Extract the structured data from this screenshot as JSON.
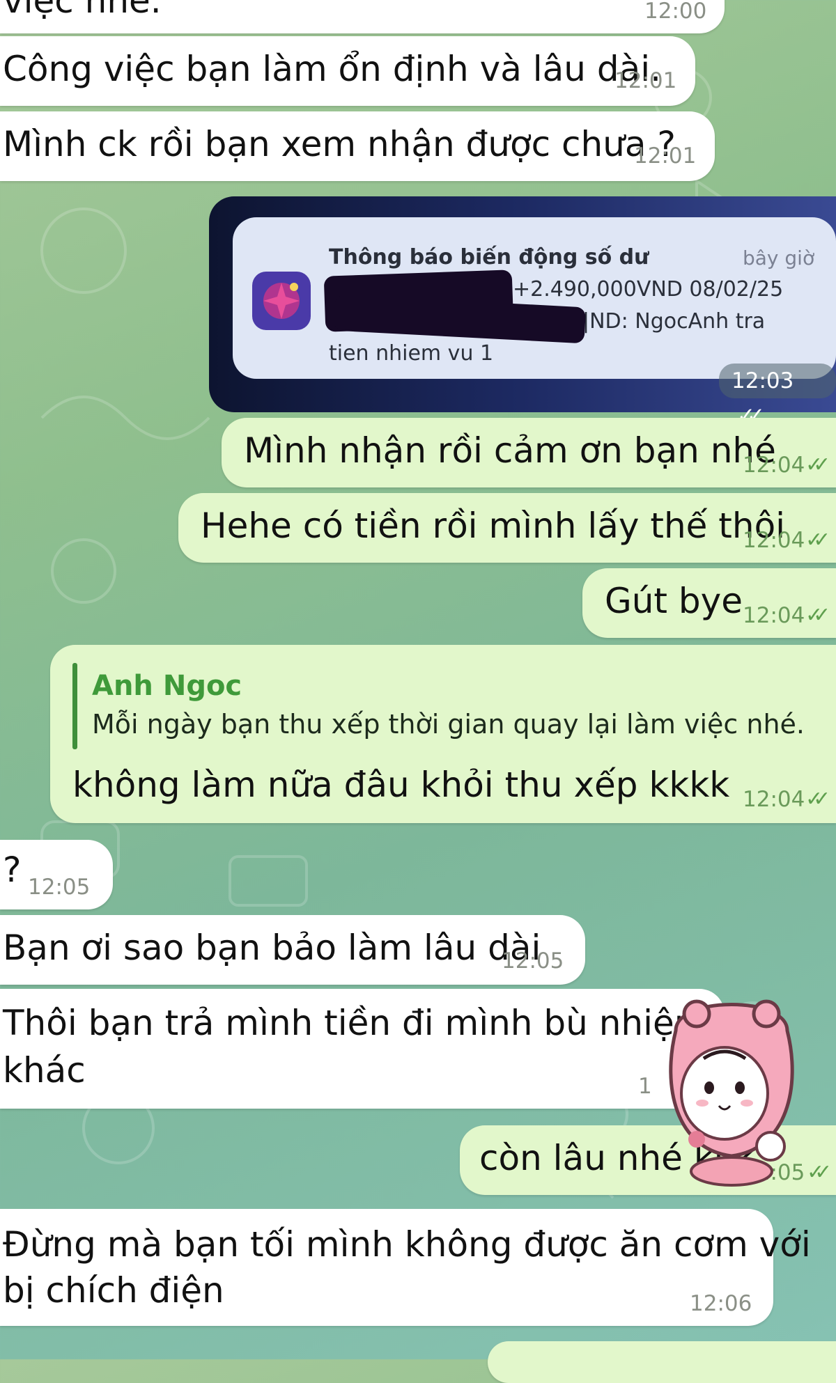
{
  "messages": [
    {
      "text": "việc nhé.",
      "time": "12:00"
    },
    {
      "text": "Công việc bạn làm ổn định và lâu dài.",
      "time": "12:01"
    },
    {
      "text": "Mình ck rồi bạn xem nhận được chưa ?",
      "time": "12:01"
    },
    {
      "text": "Mình nhận rồi cảm ơn bạn nhé",
      "time": "12:04"
    },
    {
      "text": "Hehe có tiền rồi mình lấy thế thôi",
      "time": "12:04"
    },
    {
      "text": "Gút bye",
      "time": "12:04"
    },
    {
      "text": "không làm nữa đâu khỏi thu xếp kkkk",
      "time": "12:04"
    },
    {
      "text": "?",
      "time": "12:05"
    },
    {
      "text": "Bạn ơi sao bạn bảo làm lâu dài",
      "time": "12:05"
    },
    {
      "text_line1": "Thôi bạn trả mình tiền đi mình bù nhiệm",
      "text_line2": "khác",
      "time": "1"
    },
    {
      "text": "còn lâu nhé kkk",
      "time": "12:05"
    },
    {
      "text_line1": "Đừng mà bạn tối mình không được ăn cơm với",
      "text_line2": "bị chích điện",
      "time": "12:06"
    }
  ],
  "notification": {
    "title": "Thông báo biến động số dư",
    "age": "bây giờ",
    "line1": "+2.490,000VND 08/02/25",
    "line2": "|ND: NgocAnh tra",
    "line3": "tien nhiem vu 1",
    "time": "12:03"
  },
  "reply": {
    "name": "Anh Ngoc",
    "quote": "Mỗi ngày bạn thu xếp thời gian quay lại làm việc nhé."
  },
  "colors": {
    "incoming_bubble": "#ffffff",
    "outgoing_bubble": "#e2f7cb",
    "reply_name": "#3f9a3a",
    "check": "#5fa04e"
  },
  "icons": {
    "read_receipt": "double-check-icon",
    "bank_app": "bank-app-icon",
    "sticker": "pink-hood-cat-sticker"
  }
}
